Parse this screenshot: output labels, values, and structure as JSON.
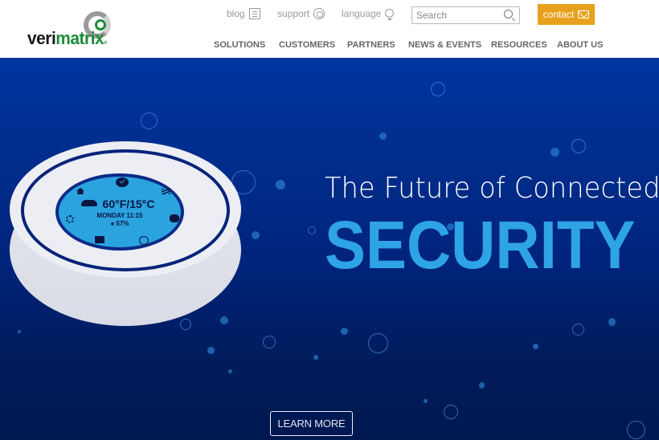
{
  "brand": {
    "logo_part1": "veri",
    "logo_part2": "matrix",
    "logo_mark": "®"
  },
  "utility_nav": [
    {
      "label": "blog",
      "icon": "document-lines-icon"
    },
    {
      "label": "support",
      "icon": "lifebuoy-icon"
    },
    {
      "label": "language",
      "icon": "globe-icon"
    }
  ],
  "search": {
    "placeholder": "Search",
    "value": "",
    "icon": "search-icon"
  },
  "contact": {
    "label": "contact",
    "icon": "envelope-icon",
    "color": "#e8a11e"
  },
  "main_nav": [
    {
      "label": "SOLUTIONS"
    },
    {
      "label": "CUSTOMERS"
    },
    {
      "label": "PARTNERS"
    },
    {
      "label": "NEWS & EVENTS"
    },
    {
      "label": "RESOURCES"
    },
    {
      "label": "ABOUT US"
    }
  ],
  "hero": {
    "headline": "The Future of Connected",
    "headline_emphasis": "SECURITY",
    "emphasis_color": "#2ea3e6",
    "cta_label": "LEARN MORE",
    "device_screen": {
      "temperature": "60°F/15°C",
      "day_time": "MONDAY 11:15",
      "humidity": "57%",
      "icons": [
        "check-icon",
        "home-icon",
        "heat-icon",
        "partly-cloudy-icon",
        "gear-icon",
        "fan-icon",
        "calendar-icon",
        "clock-icon"
      ]
    }
  }
}
